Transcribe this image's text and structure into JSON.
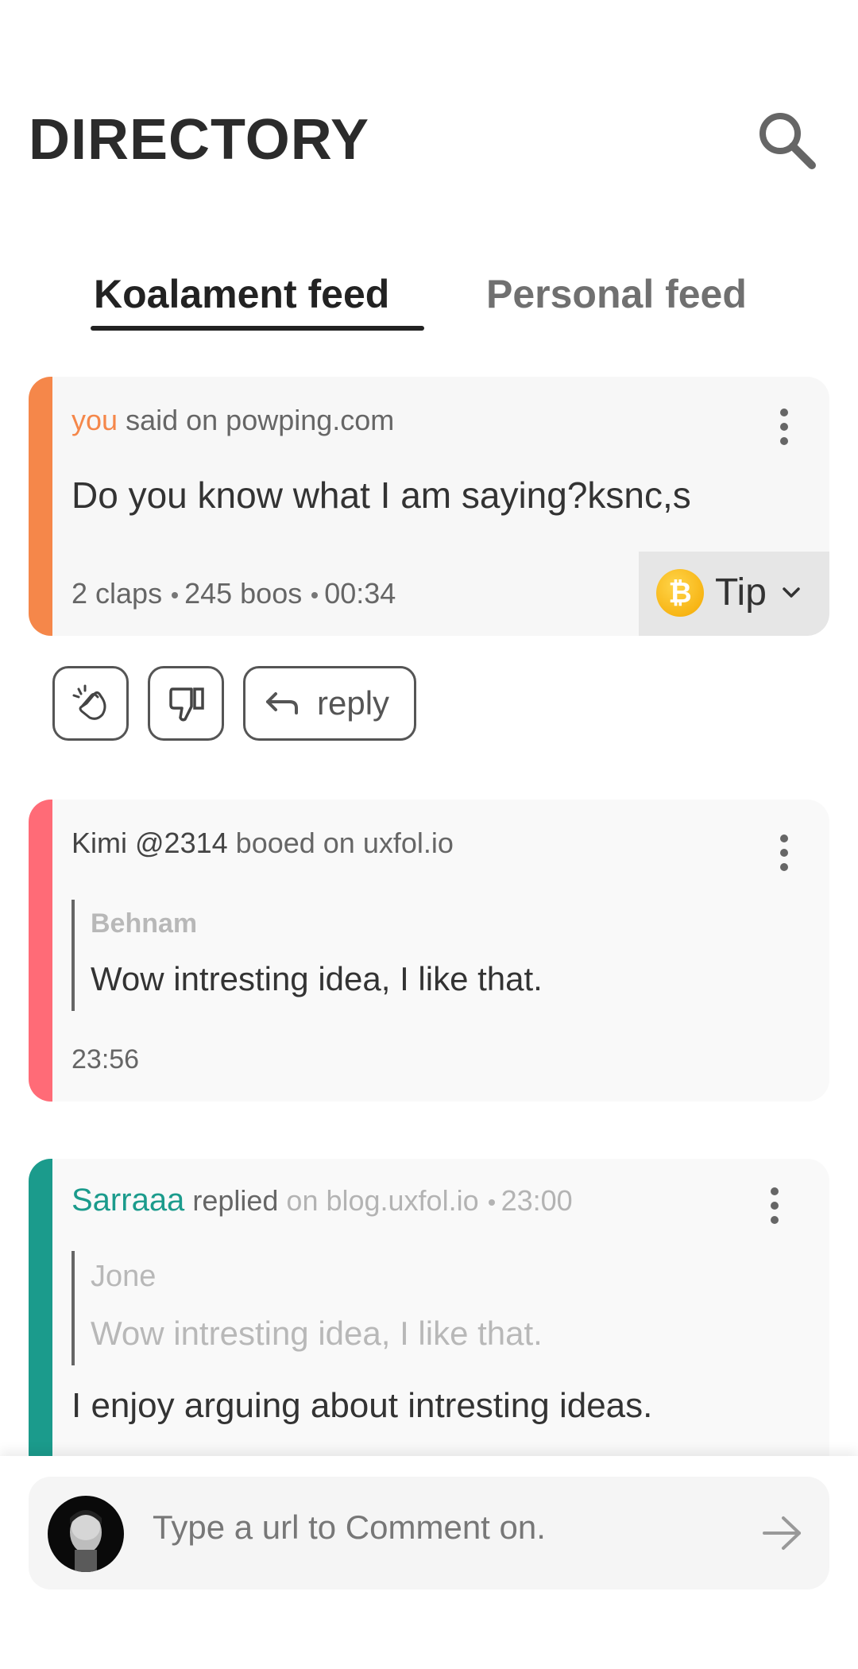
{
  "header": {
    "title": "DIRECTORY"
  },
  "tabs": [
    {
      "label": "Koalament feed",
      "active": true
    },
    {
      "label": "Personal feed",
      "active": false
    }
  ],
  "posts": [
    {
      "accent_color": "#f5874a",
      "author": "you",
      "verb": "said on",
      "site": "powping.com",
      "text": "Do you know what I am saying?ksnc,s",
      "claps": "2 claps",
      "boos": "245 boos",
      "time": "00:34",
      "tip_label": "Tip"
    },
    {
      "accent_color": "#ff6b77",
      "author": "Kimi",
      "handle": "@2314",
      "verb": "booed on",
      "site": "uxfol.io",
      "quote_author": "Behnam",
      "quote_text": "Wow intresting idea, I  like that.",
      "time": "23:56"
    },
    {
      "accent_color": "#1b9b8c",
      "author": "Sarraaa",
      "verb": "replied",
      "site": "on blog.uxfol.io",
      "time": "23:00",
      "quote_author": "Jone",
      "quote_text": "Wow intresting idea, I  like that.",
      "text": "I enjoy arguing about intresting ideas."
    }
  ],
  "actions": {
    "reply_label": "reply"
  },
  "composer": {
    "placeholder": "Type a url to Comment on."
  },
  "icons": {
    "search": "search-icon",
    "menu": "kebab-menu-icon",
    "coin": "bitcoin-icon",
    "clap": "clap-icon",
    "boo": "thumbs-down-icon",
    "reply": "reply-arrow-icon",
    "send": "send-arrow-icon"
  }
}
